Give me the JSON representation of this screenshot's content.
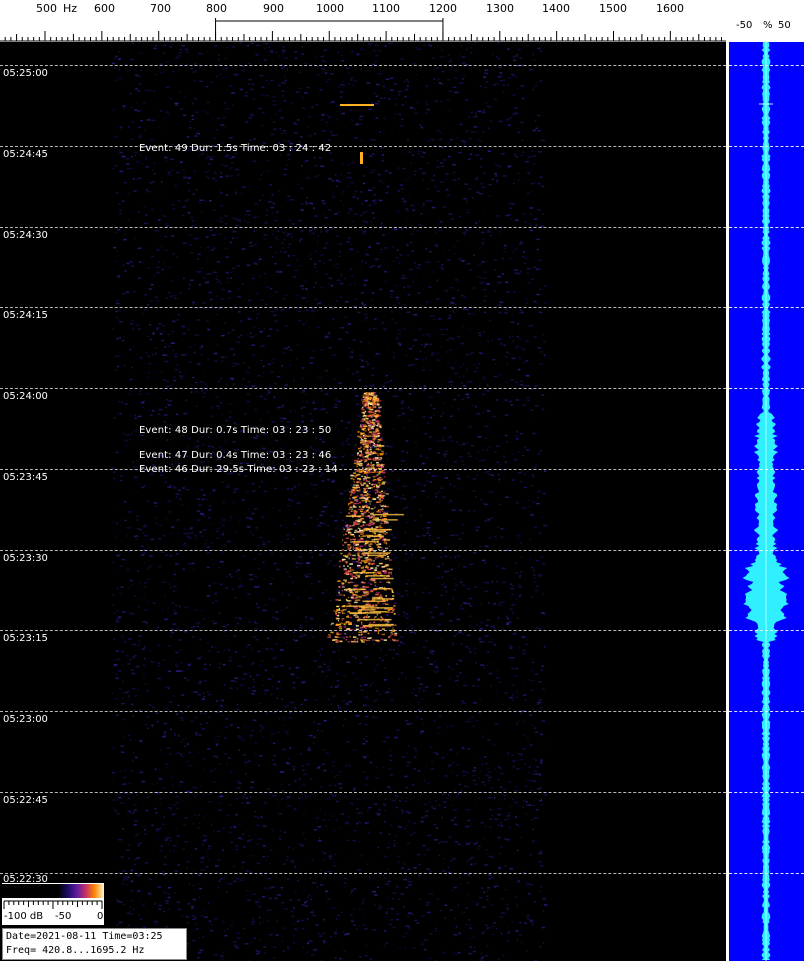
{
  "ruler": {
    "labels": [
      {
        "text": "500",
        "hz": 500
      },
      {
        "text": "Hz",
        "hz": null
      },
      {
        "text": "600",
        "hz": 600
      },
      {
        "text": "700",
        "hz": 700
      },
      {
        "text": "800",
        "hz": 800
      },
      {
        "text": "900",
        "hz": 900
      },
      {
        "text": "1000",
        "hz": 1000
      },
      {
        "text": "1100",
        "hz": 1100
      },
      {
        "text": "1200",
        "hz": 1200
      },
      {
        "text": "1300",
        "hz": 1300
      },
      {
        "text": "1400",
        "hz": 1400
      },
      {
        "text": "1500",
        "hz": 1500
      },
      {
        "text": "1600",
        "hz": 1600
      }
    ],
    "passband_hz": [
      800,
      1200
    ]
  },
  "side": {
    "label_minus": "-50",
    "label_pct": "%",
    "label_plus": "50",
    "band_color": "#0000ff",
    "trace_color": "#30f0ff"
  },
  "times": [
    "05:25:00",
    "05:24:45",
    "05:24:30",
    "05:24:15",
    "05:24:00",
    "05:23:45",
    "05:23:30",
    "05:23:15",
    "05:23:00",
    "05:22:45",
    "05:22:30"
  ],
  "events": [
    {
      "text": "Event: 49  Dur: 1.5s  Time: 03 : 24 : 42"
    },
    {
      "text": "Event: 48  Dur: 0.7s  Time: 03 : 23 : 50"
    },
    {
      "text": "Event: 47  Dur: 0.4s  Time: 03 : 23 : 46"
    },
    {
      "text": "Event: 46  Dur: 29.5s  Time: 03 : 23 : 14"
    }
  ],
  "colorbar": {
    "label_min": "-100 dB",
    "label_mid": "-50",
    "label_max": "0"
  },
  "info": {
    "date_line": "Date=2021-08-11 Time=03:25",
    "freq_line": "Freq= 420.8...1695.2 Hz"
  },
  "colors": {
    "signal_hot": "#ffb020",
    "signal_warm": "#c0306a",
    "noise": "#2a1a80"
  }
}
